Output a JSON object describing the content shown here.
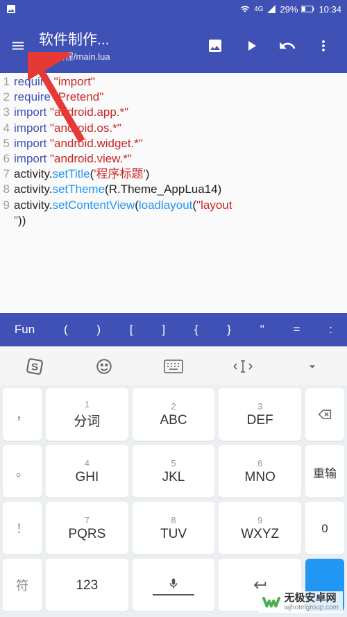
{
  "status": {
    "network": "4G",
    "battery": "29%",
    "time": "10:34"
  },
  "appbar": {
    "title": "软件制作...",
    "subtitle": "...作教程/main.lua"
  },
  "code": {
    "lines": [
      {
        "n": "1",
        "tokens": [
          [
            "kw",
            "require"
          ],
          [
            " "
          ],
          [
            "str",
            "\"import\""
          ]
        ]
      },
      {
        "n": "2",
        "tokens": [
          [
            "kw",
            "require"
          ],
          [
            " "
          ],
          [
            "str",
            "\"Pretend\""
          ]
        ]
      },
      {
        "n": "3",
        "tokens": [
          [
            "kw",
            "import"
          ],
          [
            " "
          ],
          [
            "str",
            "\"android.app.*\""
          ]
        ]
      },
      {
        "n": "4",
        "tokens": [
          [
            "kw",
            "import"
          ],
          [
            " "
          ],
          [
            "str",
            "\"android.os.*\""
          ]
        ]
      },
      {
        "n": "5",
        "tokens": [
          [
            "kw",
            "import"
          ],
          [
            " "
          ],
          [
            "str",
            "\"android.widget.*\""
          ]
        ]
      },
      {
        "n": "6",
        "tokens": [
          [
            "kw",
            "import"
          ],
          [
            " "
          ],
          [
            "str",
            "\"android.view.*\""
          ]
        ]
      },
      {
        "n": "7",
        "tokens": [
          [
            "id",
            "activity"
          ],
          [
            "id",
            "."
          ],
          [
            "fn",
            "setTitle"
          ],
          [
            "id",
            "("
          ],
          [
            "str",
            "'程序标题'"
          ],
          [
            "id",
            ")"
          ]
        ]
      },
      {
        "n": "8",
        "tokens": [
          [
            "id",
            "activity"
          ],
          [
            "id",
            "."
          ],
          [
            "fn",
            "setTheme"
          ],
          [
            "id",
            "("
          ],
          [
            "id",
            "R"
          ],
          [
            "id",
            "."
          ],
          [
            "id",
            "Theme_AppLua14"
          ],
          [
            "id",
            ")"
          ]
        ]
      },
      {
        "n": "9",
        "tokens": [
          [
            "id",
            "activity"
          ],
          [
            "id",
            "."
          ],
          [
            "fn",
            "setContentView"
          ],
          [
            "id",
            "("
          ],
          [
            "fn",
            "loadlayout"
          ],
          [
            "id",
            "("
          ],
          [
            "str",
            "\"layout"
          ]
        ]
      },
      {
        "n": " ",
        "tokens": [
          [
            "str",
            "\""
          ],
          [
            "id",
            "))"
          ]
        ]
      }
    ]
  },
  "symbols": [
    "Fun",
    "(",
    ")",
    "[",
    "]",
    "{",
    "}",
    "\"",
    "=",
    ":"
  ],
  "keyboard": {
    "rows": [
      {
        "side_left": {
          "label": "，"
        },
        "keys": [
          {
            "num": "1",
            "label": "分词"
          },
          {
            "num": "2",
            "label": "ABC"
          },
          {
            "num": "3",
            "label": "DEF"
          }
        ],
        "side_right": {
          "type": "backspace"
        }
      },
      {
        "side_left": {
          "label": "。"
        },
        "keys": [
          {
            "num": "4",
            "label": "GHI"
          },
          {
            "num": "5",
            "label": "JKL"
          },
          {
            "num": "6",
            "label": "MNO"
          }
        ],
        "side_right": {
          "label": "重输"
        }
      },
      {
        "side_left": {
          "label": "！"
        },
        "keys": [
          {
            "num": "7",
            "label": "PQRS"
          },
          {
            "num": "8",
            "label": "TUV"
          },
          {
            "num": "9",
            "label": "WXYZ"
          }
        ],
        "side_right": {
          "label": "0"
        }
      },
      {
        "side_left": {
          "label": "符"
        },
        "keys": [
          {
            "label": "123"
          },
          {
            "type": "space"
          },
          {
            "type": "enter"
          }
        ],
        "side_right": {
          "type": "blue"
        }
      }
    ]
  },
  "watermark": {
    "cn": "无极安卓网",
    "url": "wjhotelgroup.com"
  }
}
